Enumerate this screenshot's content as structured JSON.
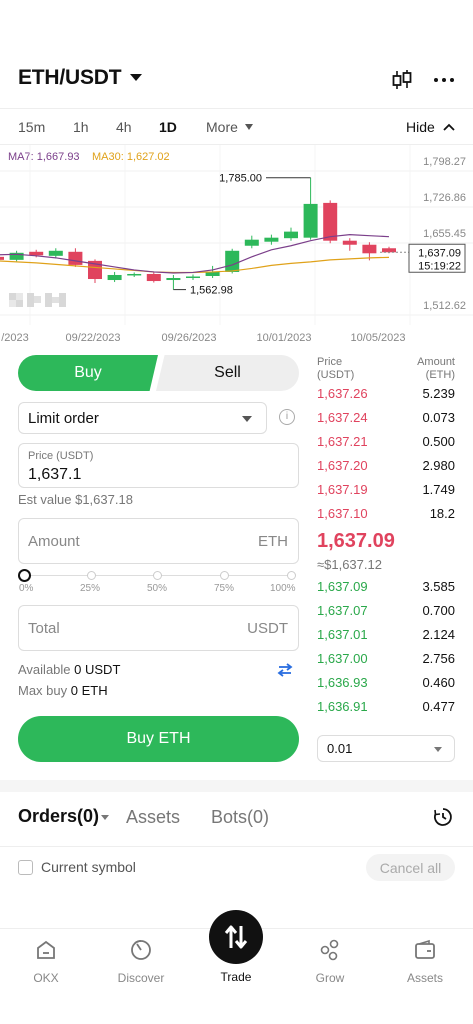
{
  "header": {
    "pair": "ETH/USDT",
    "icons": [
      "candlestick-icon",
      "more-icon"
    ]
  },
  "timeframes": [
    "15m",
    "1h",
    "4h",
    "1D",
    "More"
  ],
  "active_timeframe": "1D",
  "hide_label": "Hide",
  "ma": {
    "ma7": "MA7: 1,667.93",
    "ma30": "MA30: 1,627.02",
    "ma7_color": "#7b3f8a",
    "ma30_color": "#e0a21a"
  },
  "chart_data": {
    "type": "candlestick",
    "y_ticks": [
      "1,798.27",
      "1,726.86",
      "1,655.45",
      "1,512.62"
    ],
    "x_ticks": [
      "/2023",
      "09/22/2023",
      "09/26/2023",
      "10/01/2023",
      "10/05/2023"
    ],
    "high_label": "1,785.00",
    "low_label": "1,562.98",
    "current_price_label": "1,637.09",
    "countdown": "15:19:22",
    "watermark": "OKX",
    "up_color": "#2db85a",
    "down_color": "#e0435e",
    "candles": [
      {
        "open": 1628,
        "close": 1622,
        "high": 1637,
        "low": 1612
      },
      {
        "open": 1622,
        "close": 1636,
        "high": 1640,
        "low": 1619
      },
      {
        "open": 1638,
        "close": 1631,
        "high": 1642,
        "low": 1627
      },
      {
        "open": 1630,
        "close": 1640,
        "high": 1645,
        "low": 1625
      },
      {
        "open": 1638,
        "close": 1612,
        "high": 1645,
        "low": 1608
      },
      {
        "open": 1620,
        "close": 1584,
        "high": 1623,
        "low": 1576
      },
      {
        "open": 1582,
        "close": 1592,
        "high": 1598,
        "low": 1578
      },
      {
        "open": 1592,
        "close": 1594,
        "high": 1597,
        "low": 1588
      },
      {
        "open": 1594,
        "close": 1580,
        "high": 1599,
        "low": 1577
      },
      {
        "open": 1582,
        "close": 1586,
        "high": 1592,
        "low": 1563
      },
      {
        "open": 1586,
        "close": 1589,
        "high": 1593,
        "low": 1582
      },
      {
        "open": 1590,
        "close": 1598,
        "high": 1610,
        "low": 1586
      },
      {
        "open": 1598,
        "close": 1640,
        "high": 1644,
        "low": 1595
      },
      {
        "open": 1650,
        "close": 1662,
        "high": 1670,
        "low": 1645
      },
      {
        "open": 1658,
        "close": 1666,
        "high": 1672,
        "low": 1652
      },
      {
        "open": 1665,
        "close": 1678,
        "high": 1686,
        "low": 1660
      },
      {
        "open": 1666,
        "close": 1733,
        "high": 1785,
        "low": 1662
      },
      {
        "open": 1735,
        "close": 1660,
        "high": 1740,
        "low": 1655
      },
      {
        "open": 1660,
        "close": 1652,
        "high": 1665,
        "low": 1640
      },
      {
        "open": 1652,
        "close": 1635,
        "high": 1657,
        "low": 1621
      },
      {
        "open": 1645,
        "close": 1637,
        "high": 1648,
        "low": 1635
      }
    ],
    "ma7_values": [
      1632,
      1633,
      1630,
      1626,
      1620,
      1614,
      1608,
      1602,
      1598,
      1596,
      1597,
      1602,
      1612,
      1628,
      1642,
      1650,
      1660,
      1668,
      1672,
      1670,
      1668
    ],
    "ma30_values": [
      1620,
      1618,
      1616,
      1613,
      1610,
      1607,
      1604,
      1601,
      1598,
      1597,
      1597,
      1598,
      1600,
      1605,
      1611,
      1615,
      1618,
      1622,
      1624,
      1626,
      1627
    ]
  },
  "trade": {
    "buy_tab": "Buy",
    "sell_tab": "Sell",
    "order_type": "Limit order",
    "price_label": "Price (USDT)",
    "price_value": "1,637.1",
    "est_value": "Est value $1,637.18",
    "amount_placeholder": "Amount",
    "amount_unit": "ETH",
    "slider_percent": 0,
    "slider_marks": [
      "0%",
      "25%",
      "50%",
      "75%",
      "100%"
    ],
    "total_placeholder": "Total",
    "total_unit": "USDT",
    "available_label": "Available",
    "available_value": "0 USDT",
    "max_buy_label": "Max buy",
    "max_buy_value": "0 ETH",
    "buy_button": "Buy ETH"
  },
  "order_book": {
    "price_header_1": "Price",
    "price_header_2": "(USDT)",
    "amount_header_1": "Amount",
    "amount_header_2": "(ETH)",
    "asks": [
      {
        "price": "1,637.26",
        "amount": "5.239"
      },
      {
        "price": "1,637.24",
        "amount": "0.073"
      },
      {
        "price": "1,637.21",
        "amount": "0.500"
      },
      {
        "price": "1,637.20",
        "amount": "2.980"
      },
      {
        "price": "1,637.19",
        "amount": "1.749"
      },
      {
        "price": "1,637.10",
        "amount": "18.2"
      }
    ],
    "last_price": "1,637.09",
    "last_usd": "≈$1,637.12",
    "bids": [
      {
        "price": "1,637.09",
        "amount": "3.585"
      },
      {
        "price": "1,637.07",
        "amount": "0.700"
      },
      {
        "price": "1,637.01",
        "amount": "2.124"
      },
      {
        "price": "1,637.00",
        "amount": "2.756"
      },
      {
        "price": "1,636.93",
        "amount": "0.460"
      },
      {
        "price": "1,636.91",
        "amount": "0.477"
      }
    ],
    "depth": "0.01"
  },
  "orders": {
    "tab_orders": "Orders(0)",
    "tab_assets": "Assets",
    "tab_bots": "Bots(0)",
    "current_symbol": "Current symbol",
    "cancel_all": "Cancel all"
  },
  "nav": [
    {
      "label": "OKX",
      "icon": "home-icon"
    },
    {
      "label": "Discover",
      "icon": "discover-icon"
    },
    {
      "label": "Trade",
      "icon": "trade-icon"
    },
    {
      "label": "Grow",
      "icon": "grow-icon"
    },
    {
      "label": "Assets",
      "icon": "wallet-icon"
    }
  ]
}
